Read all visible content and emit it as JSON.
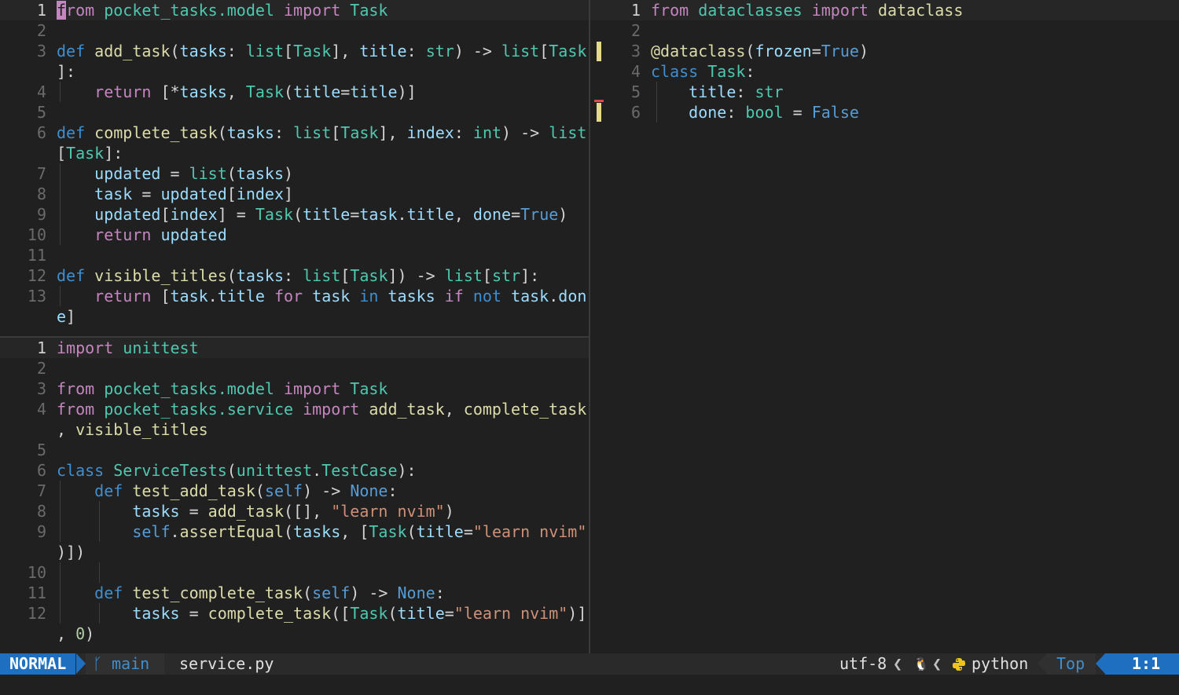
{
  "panes": {
    "service": {
      "lines": [
        {
          "num": "1",
          "current": true,
          "tokens": [
            [
              "cursor",
              "f"
            ],
            [
              "kw2",
              "rom "
            ],
            [
              "mod",
              "pocket_tasks.model"
            ],
            [
              "kw2",
              " import "
            ],
            [
              "ty",
              "Task"
            ]
          ]
        },
        {
          "num": "2",
          "tokens": []
        },
        {
          "num": "3",
          "tokens": [
            [
              "kw",
              "def "
            ],
            [
              "fn",
              "add_task"
            ],
            [
              "punc",
              "("
            ],
            [
              "var",
              "tasks"
            ],
            [
              "punc",
              ": "
            ],
            [
              "ty",
              "list"
            ],
            [
              "punc",
              "["
            ],
            [
              "ty",
              "Task"
            ],
            [
              "punc",
              "], "
            ],
            [
              "var",
              "title"
            ],
            [
              "punc",
              ": "
            ],
            [
              "ty",
              "str"
            ],
            [
              "punc",
              ") -> "
            ],
            [
              "ty",
              "list"
            ],
            [
              "punc",
              "["
            ],
            [
              "ty",
              "Task"
            ]
          ]
        },
        {
          "num": "",
          "tokens": [
            [
              "punc",
              "]:"
            ]
          ]
        },
        {
          "num": "4",
          "guides": [
            76
          ],
          "tokens": [
            [
              "kw2",
              "    return "
            ],
            [
              "punc",
              "[*"
            ],
            [
              "var",
              "tasks"
            ],
            [
              "punc",
              ", "
            ],
            [
              "ty",
              "Task"
            ],
            [
              "punc",
              "("
            ],
            [
              "var",
              "title"
            ],
            [
              "punc",
              "="
            ],
            [
              "var",
              "title"
            ],
            [
              "punc",
              ")]"
            ]
          ]
        },
        {
          "num": "5",
          "tokens": []
        },
        {
          "num": "6",
          "tokens": [
            [
              "kw",
              "def "
            ],
            [
              "fn",
              "complete_task"
            ],
            [
              "punc",
              "("
            ],
            [
              "var",
              "tasks"
            ],
            [
              "punc",
              ": "
            ],
            [
              "ty",
              "list"
            ],
            [
              "punc",
              "["
            ],
            [
              "ty",
              "Task"
            ],
            [
              "punc",
              "], "
            ],
            [
              "var",
              "index"
            ],
            [
              "punc",
              ": "
            ],
            [
              "ty",
              "int"
            ],
            [
              "punc",
              ") -> "
            ],
            [
              "ty",
              "list"
            ]
          ]
        },
        {
          "num": "",
          "tokens": [
            [
              "punc",
              "["
            ],
            [
              "ty",
              "Task"
            ],
            [
              "punc",
              "]:"
            ]
          ]
        },
        {
          "num": "7",
          "guides": [
            76
          ],
          "tokens": [
            [
              "var",
              "    updated"
            ],
            [
              "punc",
              " = "
            ],
            [
              "ty",
              "list"
            ],
            [
              "punc",
              "("
            ],
            [
              "var",
              "tasks"
            ],
            [
              "punc",
              ")"
            ]
          ]
        },
        {
          "num": "8",
          "guides": [
            76
          ],
          "tokens": [
            [
              "var",
              "    task"
            ],
            [
              "punc",
              " = "
            ],
            [
              "var",
              "updated"
            ],
            [
              "punc",
              "["
            ],
            [
              "var",
              "index"
            ],
            [
              "punc",
              "]"
            ]
          ]
        },
        {
          "num": "9",
          "guides": [
            76
          ],
          "tokens": [
            [
              "var",
              "    updated"
            ],
            [
              "punc",
              "["
            ],
            [
              "var",
              "index"
            ],
            [
              "punc",
              "] = "
            ],
            [
              "ty",
              "Task"
            ],
            [
              "punc",
              "("
            ],
            [
              "var",
              "title"
            ],
            [
              "punc",
              "="
            ],
            [
              "var",
              "task"
            ],
            [
              "punc",
              "."
            ],
            [
              "var",
              "title"
            ],
            [
              "punc",
              ", "
            ],
            [
              "var",
              "done"
            ],
            [
              "punc",
              "="
            ],
            [
              "bool",
              "True"
            ],
            [
              "punc",
              ")"
            ]
          ]
        },
        {
          "num": "10",
          "guides": [
            76
          ],
          "tokens": [
            [
              "kw2",
              "    return "
            ],
            [
              "var",
              "updated"
            ]
          ]
        },
        {
          "num": "11",
          "tokens": []
        },
        {
          "num": "12",
          "tokens": [
            [
              "kw",
              "def "
            ],
            [
              "fn",
              "visible_titles"
            ],
            [
              "punc",
              "("
            ],
            [
              "var",
              "tasks"
            ],
            [
              "punc",
              ": "
            ],
            [
              "ty",
              "list"
            ],
            [
              "punc",
              "["
            ],
            [
              "ty",
              "Task"
            ],
            [
              "punc",
              "]) -> "
            ],
            [
              "ty",
              "list"
            ],
            [
              "punc",
              "["
            ],
            [
              "ty",
              "str"
            ],
            [
              "punc",
              "]:"
            ]
          ]
        },
        {
          "num": "13",
          "guides": [
            76
          ],
          "tokens": [
            [
              "kw2",
              "    return "
            ],
            [
              "punc",
              "["
            ],
            [
              "var",
              "task"
            ],
            [
              "punc",
              "."
            ],
            [
              "var",
              "title"
            ],
            [
              "kw2",
              " for "
            ],
            [
              "var",
              "task"
            ],
            [
              "kw",
              " in "
            ],
            [
              "var",
              "tasks"
            ],
            [
              "kw2",
              " if "
            ],
            [
              "kw",
              "not "
            ],
            [
              "var",
              "task"
            ],
            [
              "punc",
              "."
            ],
            [
              "var",
              "don"
            ]
          ]
        },
        {
          "num": "",
          "tokens": [
            [
              "var",
              "e"
            ],
            [
              "punc",
              "]"
            ]
          ]
        }
      ]
    },
    "test": {
      "lines": [
        {
          "num": "1",
          "current": true,
          "tokens": [
            [
              "kw2",
              "import "
            ],
            [
              "mod",
              "unittest"
            ]
          ]
        },
        {
          "num": "2",
          "tokens": []
        },
        {
          "num": "3",
          "tokens": [
            [
              "kw2",
              "from "
            ],
            [
              "mod",
              "pocket_tasks.model"
            ],
            [
              "kw2",
              " import "
            ],
            [
              "ty",
              "Task"
            ]
          ]
        },
        {
          "num": "4",
          "tokens": [
            [
              "kw2",
              "from "
            ],
            [
              "mod",
              "pocket_tasks.service"
            ],
            [
              "kw2",
              " import "
            ],
            [
              "fn",
              "add_task"
            ],
            [
              "punc",
              ", "
            ],
            [
              "fn",
              "complete_task"
            ]
          ]
        },
        {
          "num": "",
          "tokens": [
            [
              "punc",
              ", "
            ],
            [
              "fn",
              "visible_titles"
            ]
          ]
        },
        {
          "num": "5",
          "tokens": []
        },
        {
          "num": "6",
          "tokens": [
            [
              "kw",
              "class "
            ],
            [
              "ty",
              "ServiceTests"
            ],
            [
              "punc",
              "("
            ],
            [
              "mod",
              "unittest"
            ],
            [
              "punc",
              "."
            ],
            [
              "ty",
              "TestCase"
            ],
            [
              "punc",
              "):"
            ]
          ]
        },
        {
          "num": "7",
          "guides": [
            76
          ],
          "tokens": [
            [
              "kw",
              "    def "
            ],
            [
              "fn",
              "test_add_task"
            ],
            [
              "punc",
              "("
            ],
            [
              "self",
              "self"
            ],
            [
              "punc",
              ") -> "
            ],
            [
              "bool",
              "None"
            ],
            [
              "punc",
              ":"
            ]
          ]
        },
        {
          "num": "8",
          "guides": [
            76,
            126
          ],
          "tokens": [
            [
              "var",
              "        tasks"
            ],
            [
              "punc",
              " = "
            ],
            [
              "fn",
              "add_task"
            ],
            [
              "punc",
              "([], "
            ],
            [
              "str",
              "\"learn nvim\""
            ],
            [
              "punc",
              ")"
            ]
          ]
        },
        {
          "num": "9",
          "guides": [
            76,
            126
          ],
          "tokens": [
            [
              "self",
              "        self"
            ],
            [
              "punc",
              "."
            ],
            [
              "fn",
              "assertEqual"
            ],
            [
              "punc",
              "("
            ],
            [
              "var",
              "tasks"
            ],
            [
              "punc",
              ", ["
            ],
            [
              "ty",
              "Task"
            ],
            [
              "punc",
              "("
            ],
            [
              "var",
              "title"
            ],
            [
              "punc",
              "="
            ],
            [
              "str",
              "\"learn nvim\""
            ]
          ]
        },
        {
          "num": "",
          "tokens": [
            [
              "punc",
              ")])"
            ]
          ]
        },
        {
          "num": "10",
          "guides": [
            76,
            126
          ],
          "tokens": []
        },
        {
          "num": "11",
          "guides": [
            76
          ],
          "tokens": [
            [
              "kw",
              "    def "
            ],
            [
              "fn",
              "test_complete_task"
            ],
            [
              "punc",
              "("
            ],
            [
              "self",
              "self"
            ],
            [
              "punc",
              ") -> "
            ],
            [
              "bool",
              "None"
            ],
            [
              "punc",
              ":"
            ]
          ]
        },
        {
          "num": "12",
          "guides": [
            76,
            126
          ],
          "tokens": [
            [
              "var",
              "        tasks"
            ],
            [
              "punc",
              " = "
            ],
            [
              "fn",
              "complete_task"
            ],
            [
              "punc",
              "(["
            ],
            [
              "ty",
              "Task"
            ],
            [
              "punc",
              "("
            ],
            [
              "var",
              "title"
            ],
            [
              "punc",
              "="
            ],
            [
              "str",
              "\"learn nvim\""
            ],
            [
              "punc",
              ")]"
            ]
          ]
        },
        {
          "num": "",
          "tokens": [
            [
              "punc",
              ", "
            ],
            [
              "num-lit",
              "0"
            ],
            [
              "punc",
              ")"
            ]
          ]
        }
      ]
    },
    "model": {
      "lines": [
        {
          "num": "1",
          "current": true,
          "tokens": [
            [
              "kw2",
              "from "
            ],
            [
              "mod",
              "dataclasses"
            ],
            [
              "kw2",
              " import "
            ],
            [
              "fn",
              "dataclass"
            ]
          ]
        },
        {
          "num": "2",
          "tokens": []
        },
        {
          "num": "3",
          "tokens": [
            [
              "dec",
              "@dataclass"
            ],
            [
              "punc",
              "("
            ],
            [
              "var",
              "frozen"
            ],
            [
              "punc",
              "="
            ],
            [
              "bool",
              "True"
            ],
            [
              "punc",
              ")"
            ]
          ]
        },
        {
          "num": "4",
          "tokens": [
            [
              "kw",
              "class "
            ],
            [
              "ty",
              "Task"
            ],
            [
              "punc",
              ":"
            ]
          ]
        },
        {
          "num": "5",
          "guides": [
            84
          ],
          "tokens": [
            [
              "var",
              "    title"
            ],
            [
              "punc",
              ": "
            ],
            [
              "ty",
              "str"
            ]
          ]
        },
        {
          "num": "6",
          "guides": [
            84
          ],
          "tokens": [
            [
              "var",
              "    done"
            ],
            [
              "punc",
              ": "
            ],
            [
              "ty",
              "bool"
            ],
            [
              "punc",
              " = "
            ],
            [
              "bool",
              "False"
            ]
          ]
        }
      ]
    }
  },
  "statusline": {
    "mode": "NORMAL",
    "branch_icon": "ᚴ",
    "branch": "main",
    "file": "service.py",
    "encoding": "utf-8",
    "sep": "❮",
    "os_icon": "🐧",
    "filetype": "python",
    "position": "Top",
    "line_col": "1:1"
  },
  "colors": {
    "mode_bg": "#1e6fc0",
    "background": "#202020"
  }
}
